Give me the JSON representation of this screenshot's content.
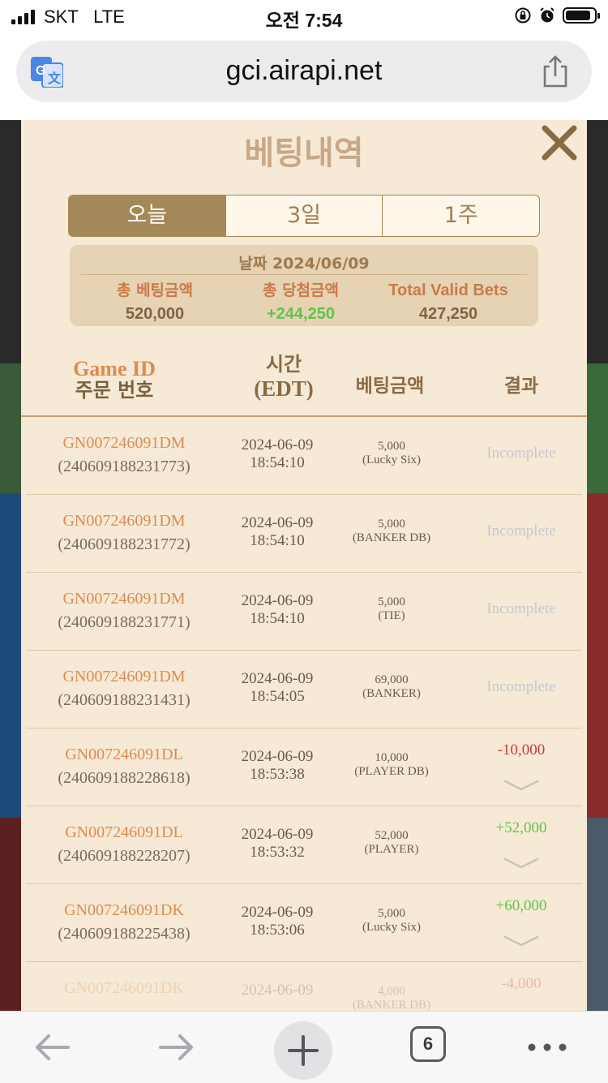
{
  "status_bar": {
    "carrier": "SKT",
    "network": "LTE",
    "time": "오전 7:54"
  },
  "browser": {
    "url": "gci.airapi.net",
    "tab_count": "6"
  },
  "popup": {
    "title": "베팅내역",
    "tabs": [
      {
        "label": "오늘",
        "active": true
      },
      {
        "label": "3일",
        "active": false
      },
      {
        "label": "1주",
        "active": false
      }
    ],
    "summary": {
      "date_label": "날짜 2024/06/09",
      "total_bet_label": "총 베팅금액",
      "total_bet_value": "520,000",
      "total_win_label": "총 당첨금액",
      "total_win_value": "+244,250",
      "valid_bets_label": "Total Valid Bets",
      "valid_bets_value": "427,250"
    },
    "columns": {
      "game_id": "Game ID",
      "order_no": "주문 번호",
      "time": "시간",
      "time_zone": "(EDT)",
      "bet_amount": "베팅금액",
      "result": "결과"
    },
    "rows": [
      {
        "game_id": "GN007246091DM",
        "order_id": "(240609188231773)",
        "date": "2024-06-09",
        "time": "18:54:10",
        "amount": "5,000",
        "bet_type": "(Lucky Six)",
        "result": "Incomplete",
        "result_kind": "incomplete"
      },
      {
        "game_id": "GN007246091DM",
        "order_id": "(240609188231772)",
        "date": "2024-06-09",
        "time": "18:54:10",
        "amount": "5,000",
        "bet_type": "(BANKER DB)",
        "result": "Incomplete",
        "result_kind": "incomplete"
      },
      {
        "game_id": "GN007246091DM",
        "order_id": "(240609188231771)",
        "date": "2024-06-09",
        "time": "18:54:10",
        "amount": "5,000",
        "bet_type": "(TIE)",
        "result": "Incomplete",
        "result_kind": "incomplete"
      },
      {
        "game_id": "GN007246091DM",
        "order_id": "(240609188231431)",
        "date": "2024-06-09",
        "time": "18:54:05",
        "amount": "69,000",
        "bet_type": "(BANKER)",
        "result": "Incomplete",
        "result_kind": "incomplete"
      },
      {
        "game_id": "GN007246091DL",
        "order_id": "(240609188228618)",
        "date": "2024-06-09",
        "time": "18:53:38",
        "amount": "10,000",
        "bet_type": "(PLAYER DB)",
        "result": "-10,000",
        "result_kind": "neg"
      },
      {
        "game_id": "GN007246091DL",
        "order_id": "(240609188228207)",
        "date": "2024-06-09",
        "time": "18:53:32",
        "amount": "52,000",
        "bet_type": "(PLAYER)",
        "result": "+52,000",
        "result_kind": "pos"
      },
      {
        "game_id": "GN007246091DK",
        "order_id": "(240609188225438)",
        "date": "2024-06-09",
        "time": "18:53:06",
        "amount": "5,000",
        "bet_type": "(Lucky Six)",
        "result": "+60,000",
        "result_kind": "pos"
      },
      {
        "game_id": "GN007246091DK",
        "order_id": "",
        "date": "2024-06-09",
        "time": "",
        "amount": "4,000",
        "bet_type": "(BANKER DB)",
        "result": "-4,000",
        "result_kind": "neg"
      }
    ]
  },
  "colors": {
    "popup_bg": "#f6ead6",
    "tab_active": "#a5885a",
    "accent_orange": "#e08a50",
    "positive": "#62c24a",
    "negative": "#d43535",
    "incomplete": "#c3c7d0"
  },
  "icons": [
    "translate-icon",
    "share-icon",
    "close-icon",
    "chevron-down-icon",
    "back-arrow-icon",
    "forward-arrow-icon",
    "plus-icon",
    "more-icon"
  ]
}
